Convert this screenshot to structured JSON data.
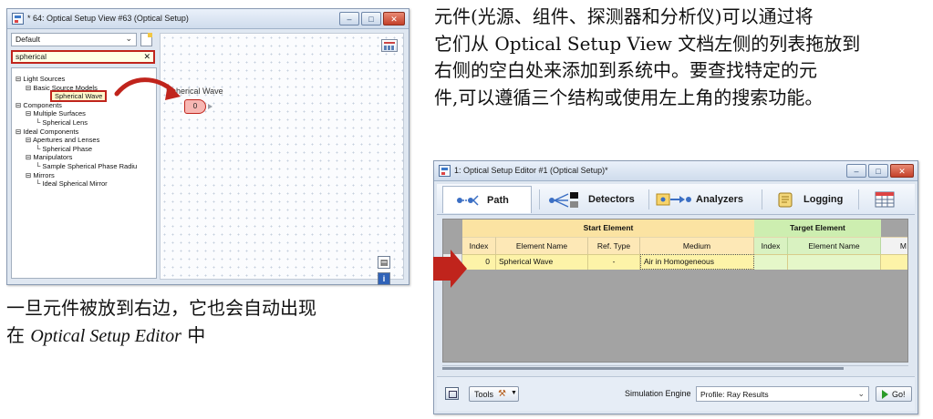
{
  "left_window": {
    "title": "* 64: Optical Setup View #63 (Optical Setup)",
    "preset_dropdown": "Default",
    "search_value": "spherical",
    "tree": [
      {
        "label": "Light Sources",
        "indent": 0,
        "prefix": "⊟"
      },
      {
        "label": "Basic Source Models",
        "indent": 1,
        "prefix": "⊟"
      },
      {
        "label": "Spherical Wave",
        "indent": 2,
        "prefix": "",
        "selected": true
      },
      {
        "label": "Components",
        "indent": 0,
        "prefix": "⊟"
      },
      {
        "label": "Multiple Surfaces",
        "indent": 1,
        "prefix": "⊟"
      },
      {
        "label": "Spherical Lens",
        "indent": 2,
        "prefix": "└"
      },
      {
        "label": "Ideal Components",
        "indent": 0,
        "prefix": "⊟"
      },
      {
        "label": "Apertures and Lenses",
        "indent": 1,
        "prefix": "⊟"
      },
      {
        "label": "Spherical Phase",
        "indent": 2,
        "prefix": "└"
      },
      {
        "label": "Manipulators",
        "indent": 1,
        "prefix": "⊟"
      },
      {
        "label": "Sample Spherical Phase Radiu",
        "indent": 2,
        "prefix": "└"
      },
      {
        "label": "Mirrors",
        "indent": 1,
        "prefix": "⊟"
      },
      {
        "label": "Ideal Spherical Mirror",
        "indent": 2,
        "prefix": "└"
      }
    ],
    "canvas_element": {
      "label": "Spherical Wave",
      "index": "0"
    }
  },
  "right_window": {
    "title": "1: Optical Setup Editor #1 (Optical Setup)*",
    "tabs": [
      {
        "label": "Path",
        "active": true
      },
      {
        "label": "Detectors"
      },
      {
        "label": "Analyzers"
      },
      {
        "label": "Logging"
      }
    ],
    "groups": {
      "start": "Start Element",
      "target": "Target Element"
    },
    "columns": {
      "start_index": "Index",
      "start_name": "Element Name",
      "ref_type": "Ref. Type",
      "medium": "Medium",
      "target_index": "Index",
      "target_name": "Element Name",
      "cut": "M"
    },
    "rows": [
      {
        "index": "0",
        "name": "Spherical Wave",
        "ref_type": "-",
        "medium": "Air in Homogeneous",
        "target_index": "",
        "target_name": ""
      }
    ],
    "bottom": {
      "tools": "Tools",
      "sim_engine_label": "Simulation Engine",
      "sim_engine_value": "Profile: Ray Results",
      "go": "Go!"
    }
  },
  "text": {
    "right_lines": [
      "元件(光源、组件、探测器和分析仪)可以通过将",
      "它们从 Optical Setup View 文档左侧的列表拖放到",
      "右侧的空白处来添加到系统中。要查找特定的元",
      "件,可以遵循三个结构或使用左上角的搜索功能。"
    ],
    "caption_line1": "一旦元件被放到右边，它也会自动出现",
    "caption_line2_pre": "在 ",
    "caption_line2_em": "Optical Setup Editor",
    "caption_line2_post": " 中"
  },
  "colors": {
    "highlight_red": "#c0241c",
    "start_group": "#fbe3a2",
    "target_group": "#cdeeb0",
    "row_yellow": "#fdf3a8"
  }
}
